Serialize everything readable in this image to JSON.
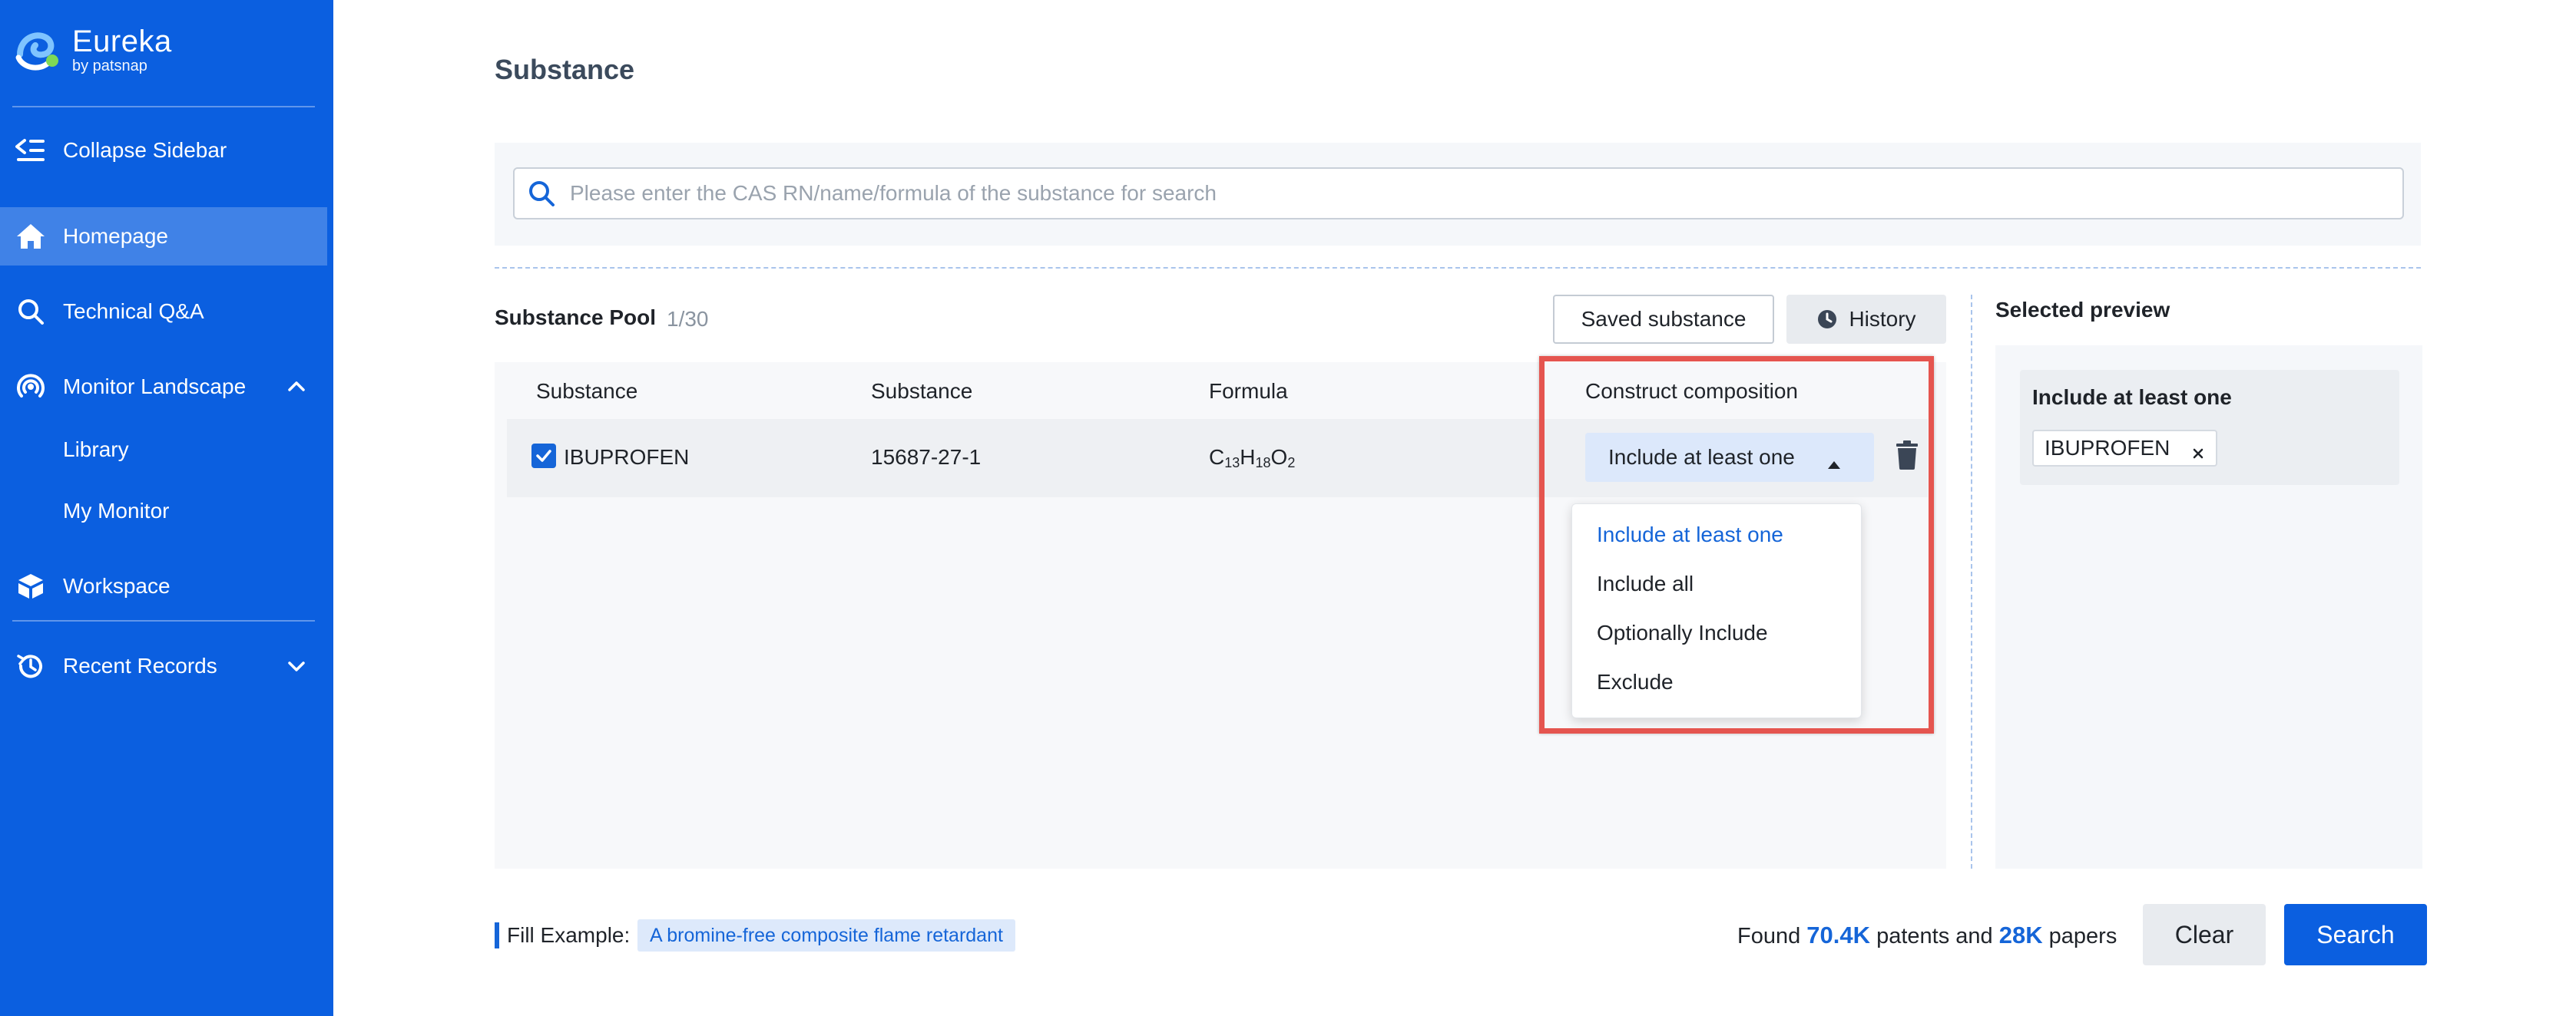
{
  "brand": {
    "name": "Eureka",
    "by": "by patsnap"
  },
  "sidebar": {
    "collapse_label": "Collapse Sidebar",
    "items": [
      {
        "label": "Homepage",
        "icon": "home-icon"
      },
      {
        "label": "Technical Q&A",
        "icon": "search-icon"
      },
      {
        "label": "Monitor Landscape",
        "icon": "radar-icon"
      },
      {
        "label": "Workspace",
        "icon": "cube-icon"
      },
      {
        "label": "Recent Records",
        "icon": "history-icon"
      }
    ],
    "monitor_sub": [
      "Library",
      "My Monitor"
    ]
  },
  "page": {
    "title": "Substance"
  },
  "search": {
    "placeholder": "Please enter the CAS RN/name/formula of the substance for search"
  },
  "pool": {
    "title": "Substance Pool",
    "count": "1/30",
    "saved_label": "Saved substance",
    "history_label": "History",
    "columns": [
      "Substance",
      "Substance",
      "Formula",
      "Construct composition"
    ],
    "rows": [
      {
        "name": "IBUPROFEN",
        "cas": "15687-27-1",
        "formula": {
          "c": "C",
          "c_n": "13",
          "h": "H",
          "h_n": "18",
          "o": "O",
          "o_n": "2"
        },
        "composition": "Include at least one",
        "checked": true
      }
    ]
  },
  "dropdown": {
    "options": [
      "Include at least one",
      "Include all",
      "Optionally Include",
      "Exclude"
    ],
    "selected": "Include at least one"
  },
  "preview": {
    "title": "Selected preview",
    "group_title": "Include at least one",
    "tags": [
      "IBUPROFEN"
    ]
  },
  "footer": {
    "fill_label": "Fill Example:",
    "fill_example": "A bromine-free composite flame retardant",
    "found_prefix": "Found",
    "patents_count": "70.4K",
    "patents_word": "patents and",
    "papers_count": "28K",
    "papers_word": "papers",
    "clear_label": "Clear",
    "search_label": "Search"
  },
  "colors": {
    "brand_blue": "#0b5fe0",
    "accent": "#1565d8",
    "highlight_border": "#e5554f"
  }
}
